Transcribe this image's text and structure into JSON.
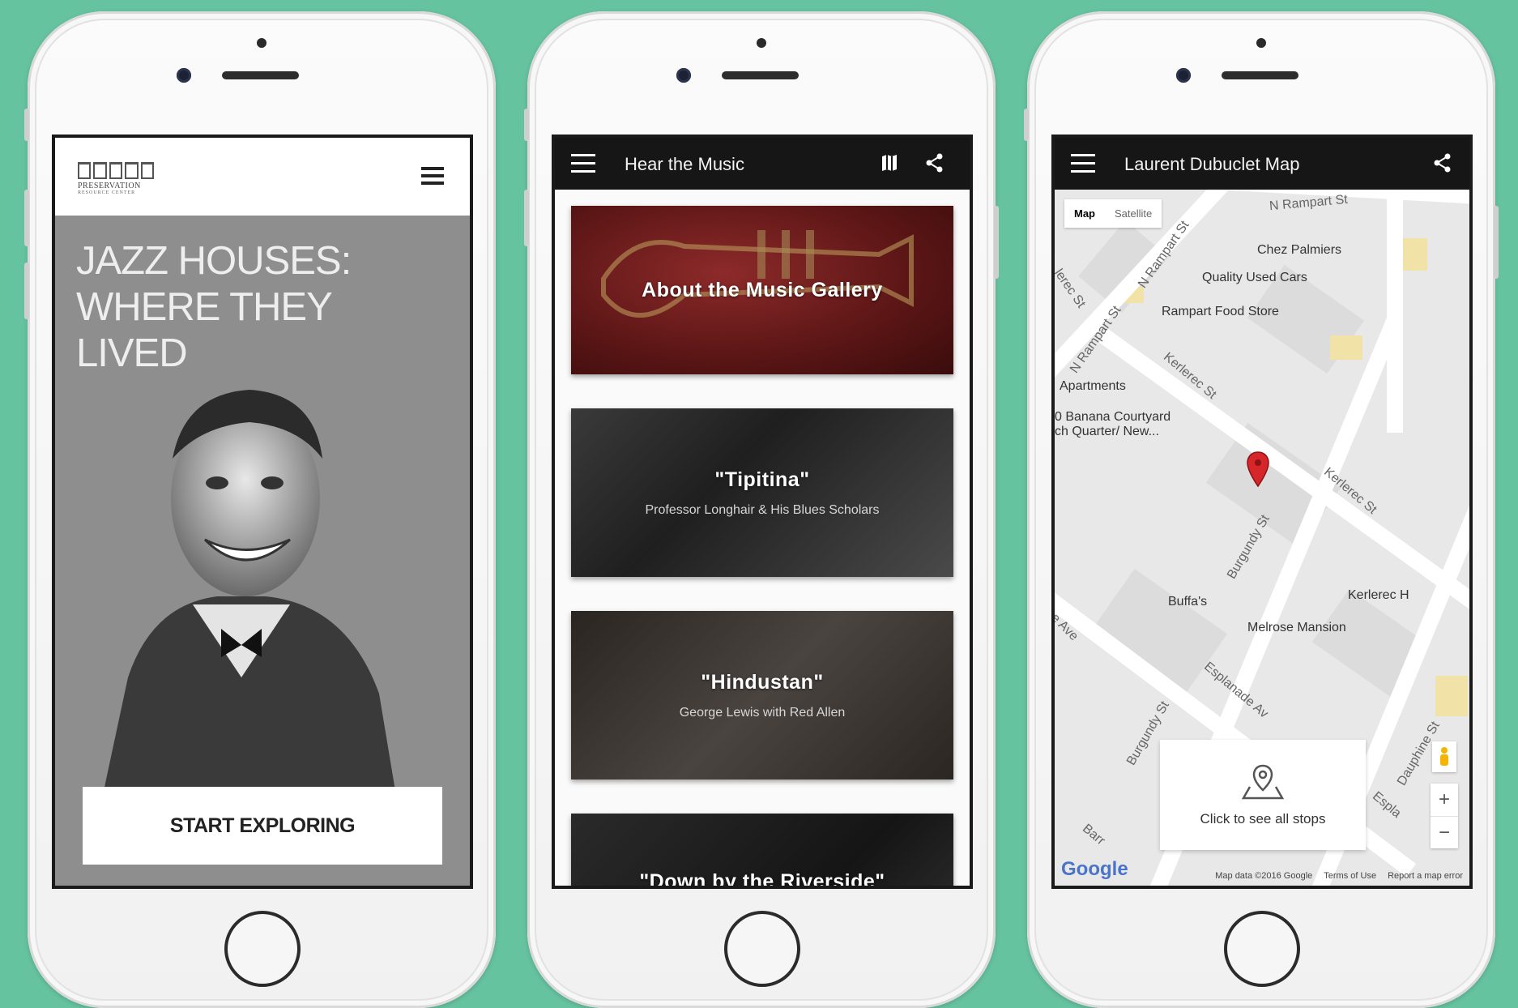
{
  "phone1": {
    "logo_text": "PRESERVATION",
    "logo_subtext": "RESOURCE CENTER",
    "hero_title_line1": "JAZZ HOUSES:",
    "hero_title_line2": "WHERE THEY",
    "hero_title_line3": "LIVED",
    "cta_label": "START EXPLORING"
  },
  "phone2": {
    "title": "Hear the Music",
    "cards": [
      {
        "title": "About the Music Gallery",
        "subtitle": ""
      },
      {
        "title": "\"Tipitina\"",
        "subtitle": "Professor Longhair & His Blues Scholars"
      },
      {
        "title": "\"Hindustan\"",
        "subtitle": "George Lewis with Red Allen"
      },
      {
        "title": "\"Down by the Riverside\"",
        "subtitle": ""
      }
    ]
  },
  "phone3": {
    "title": "Laurent Dubuclet Map",
    "map_type": {
      "map": "Map",
      "satellite": "Satellite"
    },
    "places": {
      "chez": "Chez Palmiers",
      "cars": "Quality Used Cars",
      "food": "Rampart Food Store",
      "apartments": "Apartments",
      "banana1": "0 Banana Courtyard",
      "banana2": "ch Quarter/ New...",
      "buffas": "Buffa's",
      "melrose": "Melrose Mansion",
      "kerlerec_h": "Kerlerec H"
    },
    "streets": {
      "n_rampart_top": "N Rampart St",
      "n_rampart_diag1": "N Rampart St",
      "n_rampart_diag2": "N Rampart St",
      "kerlerec1": "Kerlerec St",
      "kerlerec2": "Kerlerec St",
      "kerlerec_left": "lerec St",
      "burgundy1": "Burgundy St",
      "burgundy2": "Burgundy St",
      "esplanade": "Esplanade Av",
      "esplanade2": "Espla",
      "dauphine": "Dauphine St",
      "ave": "e Ave",
      "barr": "Barr"
    },
    "stops_label": "Click to see all stops",
    "google_logo": "Google",
    "attribution": [
      "Map data ©2016 Google",
      "Terms of Use",
      "Report a map error"
    ],
    "zoom_in": "+",
    "zoom_out": "−"
  }
}
